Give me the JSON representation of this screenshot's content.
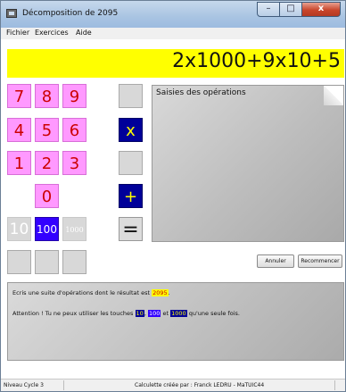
{
  "window": {
    "title": "Décomposition de 2095"
  },
  "window_buttons": {
    "minimize": "–",
    "maximize": "□",
    "close": "x"
  },
  "menu": [
    "Fichier",
    "Exercices",
    "Aide"
  ],
  "formula": "2x1000+9x10+5",
  "keypad": {
    "digits": [
      "7",
      "8",
      "9",
      "4",
      "5",
      "6",
      "1",
      "2",
      "3",
      "0"
    ],
    "multiply": "x",
    "plus": "+",
    "equals": "=",
    "ten": "10",
    "hundred": "100",
    "thousand": "1000"
  },
  "operations_panel": {
    "title": "Saisies des opérations"
  },
  "buttons": {
    "cancel": "Annuler",
    "restart": "Recommencer"
  },
  "instructions": {
    "line1_prefix": "Ecris une suite d'opérations dont le résultat est",
    "target": "2095",
    "line1_suffix": ".",
    "line2_prefix": "Attention ! Tu ne peux utiliser les touches",
    "key10": "10",
    "key100": "100",
    "and": "et",
    "key1000": "1000",
    "line2_suffix": "qu'une seule fois."
  },
  "status": {
    "level": "Niveau Cycle 3",
    "credit": "Calculette créée par : Franck LEDRU - MaTUIC44"
  },
  "colors": {
    "formula_bg": "#ffff00",
    "digit_key": "#ff99ff",
    "digit_text": "#cc0000",
    "op_key": "#000099",
    "op_text": "#ffff00",
    "hundred_key": "#3300ff"
  }
}
